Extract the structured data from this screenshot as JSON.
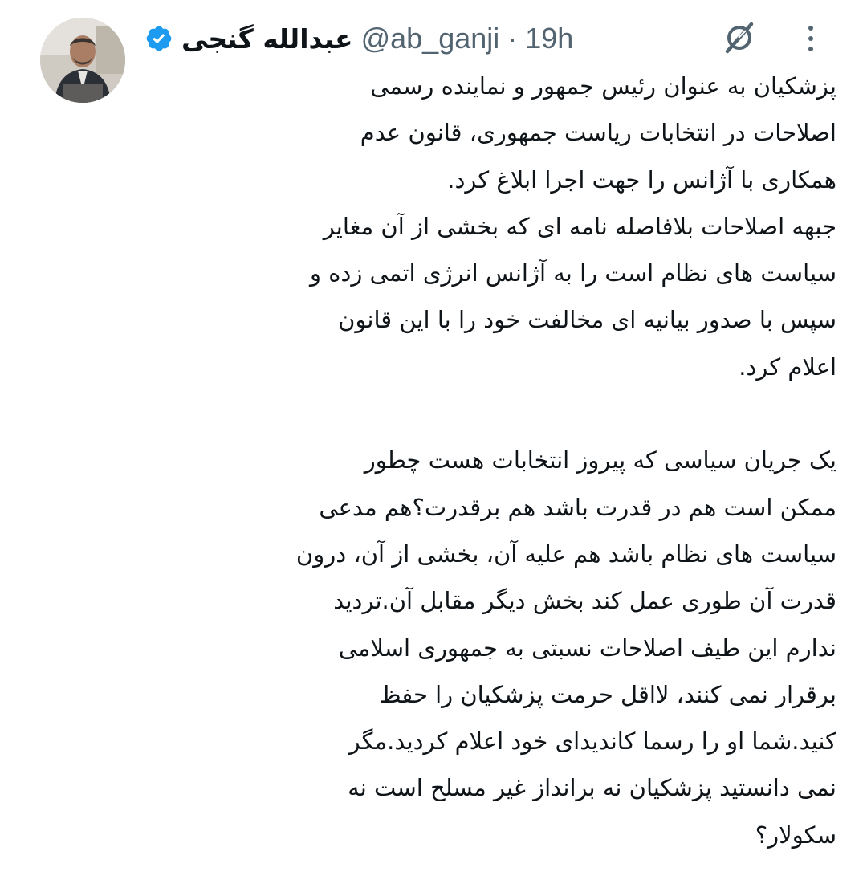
{
  "author": {
    "display_name": "عبدالله گنجی",
    "handle": "@ab_ganji",
    "separator": "·",
    "time": "19h",
    "verified": true,
    "avatar": "profile-photo"
  },
  "icons": {
    "grok": "grok-icon",
    "more": "more-options-icon",
    "verified": "verified-badge-icon"
  },
  "colors": {
    "verified_blue": "#1d9bf0",
    "text": "#0f1419",
    "secondary": "#536471"
  },
  "tweet": {
    "lines": [
      "پزشکیان به عنوان رئیس جمهور و نماینده رسمی",
      "اصلاحات در انتخابات ریاست جمهوری، قانون عدم",
      "همکاری با آژانس را جهت اجرا ابلاغ کرد.",
      "جبهه اصلاحات بلافاصله نامه ای که بخشی از آن مغایر",
      "سیاست های نظام است را به آژانس انرژی اتمی زده و",
      "سپس با صدور بیانیه ای مخالفت خود را با این قانون",
      "اعلام کرد.",
      "",
      "یک جریان سیاسی که پیروز انتخابات هست چطور",
      "ممکن است هم در قدرت باشد هم برقدرت؟هم مدعی",
      "سیاست های نظام باشد هم علیه آن، بخشی از آن، درون",
      "قدرت آن طوری عمل کند بخش دیگر مقابل آن.تردید",
      "ندارم این طیف اصلاحات نسبتی به جمهوری اسلامی",
      "برقرار نمی کنند، لااقل حرمت پزشکیان را حفظ",
      "کنید.شما او را رسما کاندیدای خود اعلام کردید.مگر",
      "نمی دانستید پزشکیان نه برانداز غیر مسلح است نه",
      "سکولار؟"
    ]
  }
}
